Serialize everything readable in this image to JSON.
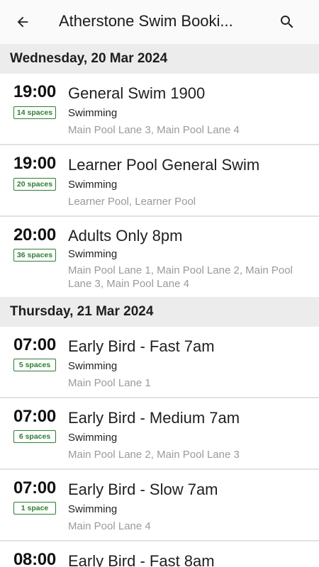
{
  "appbar": {
    "title": "Atherstone Swim Booki...",
    "back_icon": "arrow-left-icon",
    "search_icon": "search-icon"
  },
  "days": [
    {
      "label": "Wednesday, 20 Mar 2024",
      "sessions": [
        {
          "time": "19:00",
          "spaces": "14 spaces",
          "name": "General Swim 1900",
          "activity": "Swimming",
          "locations": "Main Pool Lane 3, Main Pool Lane 4"
        },
        {
          "time": "19:00",
          "spaces": "20 spaces",
          "name": "Learner Pool General Swim",
          "activity": "Swimming",
          "locations": "Learner Pool, Learner Pool"
        },
        {
          "time": "20:00",
          "spaces": "36 spaces",
          "name": "Adults Only 8pm",
          "activity": "Swimming",
          "locations": "Main Pool Lane 1, Main Pool Lane 2, Main Pool Lane 3, Main Pool Lane 4"
        }
      ]
    },
    {
      "label": "Thursday, 21 Mar 2024",
      "sessions": [
        {
          "time": "07:00",
          "spaces": "5 spaces",
          "name": "Early Bird - Fast 7am",
          "activity": "Swimming",
          "locations": "Main Pool Lane 1"
        },
        {
          "time": "07:00",
          "spaces": "6 spaces",
          "name": "Early Bird - Medium 7am",
          "activity": "Swimming",
          "locations": "Main Pool Lane 2, Main Pool Lane 3"
        },
        {
          "time": "07:00",
          "spaces": "1 space",
          "name": "Early Bird - Slow 7am",
          "activity": "Swimming",
          "locations": "Main Pool Lane 4"
        },
        {
          "time": "08:00",
          "spaces": "",
          "name": "Early Bird - Fast 8am",
          "activity": "",
          "locations": ""
        }
      ]
    }
  ],
  "colors": {
    "badge_green": "#2e7d32",
    "day_header_bg": "#ececec",
    "location_grey": "#9a9a9a"
  }
}
